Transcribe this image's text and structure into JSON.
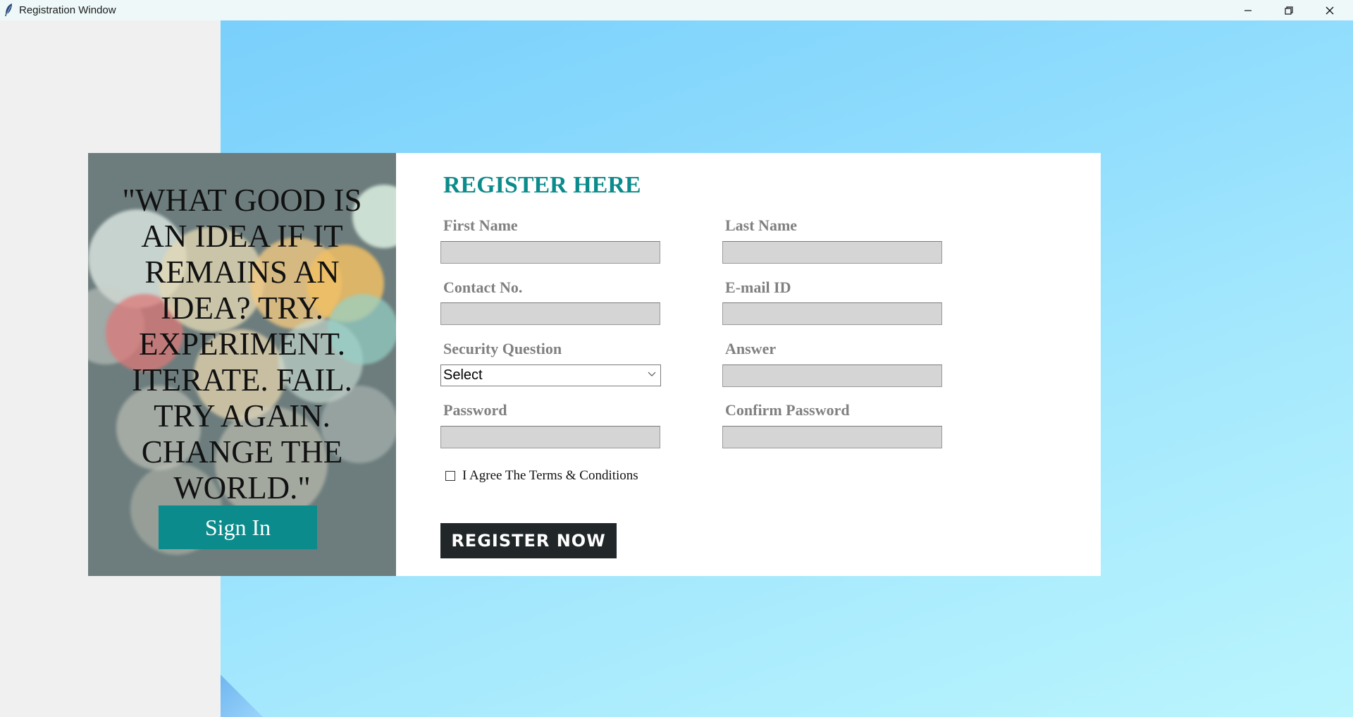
{
  "window": {
    "title": "Registration Window",
    "icon": "feather-icon",
    "controls": [
      "minimize-icon",
      "restore-icon",
      "close-icon"
    ]
  },
  "quote": {
    "text": "\"WHAT GOOD IS AN IDEA IF IT REMAINS AN IDEA?  TRY. EXPERIMENT. ITERATE. FAIL. TRY AGAIN. CHANGE THE WORLD.\"",
    "signin_label": "Sign In"
  },
  "form": {
    "title": "REGISTER HERE",
    "fields": {
      "first_name": {
        "label": "First Name",
        "value": ""
      },
      "last_name": {
        "label": "Last Name",
        "value": ""
      },
      "contact": {
        "label": "Contact No.",
        "value": ""
      },
      "email": {
        "label": "E-mail ID",
        "value": ""
      },
      "security_question": {
        "label": "Security Question",
        "value": "Select"
      },
      "answer": {
        "label": "Answer",
        "value": ""
      },
      "password": {
        "label": "Password",
        "value": ""
      },
      "confirm_password": {
        "label": "Confirm Password",
        "value": ""
      }
    },
    "terms_label": "I Agree The Terms & Conditions",
    "terms_checked": false,
    "register_label": "REGISTER NOW"
  },
  "colors": {
    "accent": "#0b8b8b",
    "label_gray": "#808080",
    "input_fill": "#d5d5d5",
    "button_dark": "#212628",
    "background_sky": "#8fdcfd"
  }
}
